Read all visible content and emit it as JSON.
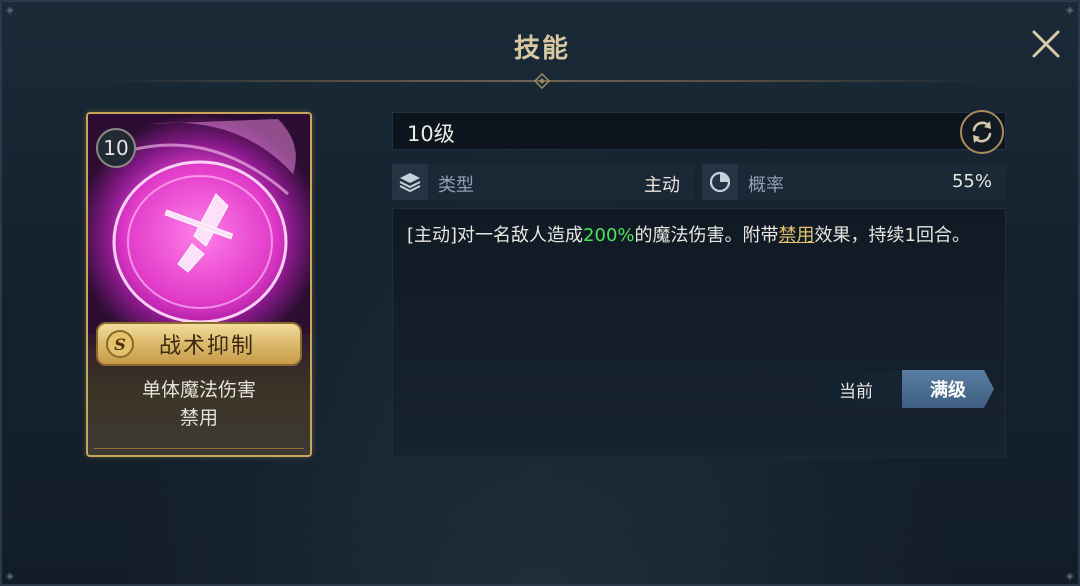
{
  "dialog": {
    "title": "技能"
  },
  "card": {
    "level": "10",
    "grade": "S",
    "name": "战术抑制",
    "tags": [
      "单体魔法伤害",
      "禁用"
    ]
  },
  "skill": {
    "level_label": "10级",
    "type_label": "类型",
    "type_value": "主动",
    "chance_label": "概率",
    "chance_value": "55%",
    "desc_prefix": "[主动]对一名敌人造成",
    "desc_damage": "200%",
    "desc_mid": "的魔法伤害。附带",
    "desc_effect": "禁用",
    "desc_suffix": "效果，持续1回合。"
  },
  "toggle": {
    "current_label": "当前",
    "max_label": "满级",
    "active": "max"
  },
  "colors": {
    "title": "#d9c7a2",
    "highlight_green": "#4be25a",
    "highlight_link": "#e2c46e",
    "card_border": "#c9a55a",
    "toggle_active": "#4f7396"
  },
  "icons": {
    "close": "close-icon",
    "refresh": "refresh-icon",
    "type": "layers-icon",
    "chance": "pie-chart-icon",
    "skill_art": "sword-emblem-icon"
  }
}
